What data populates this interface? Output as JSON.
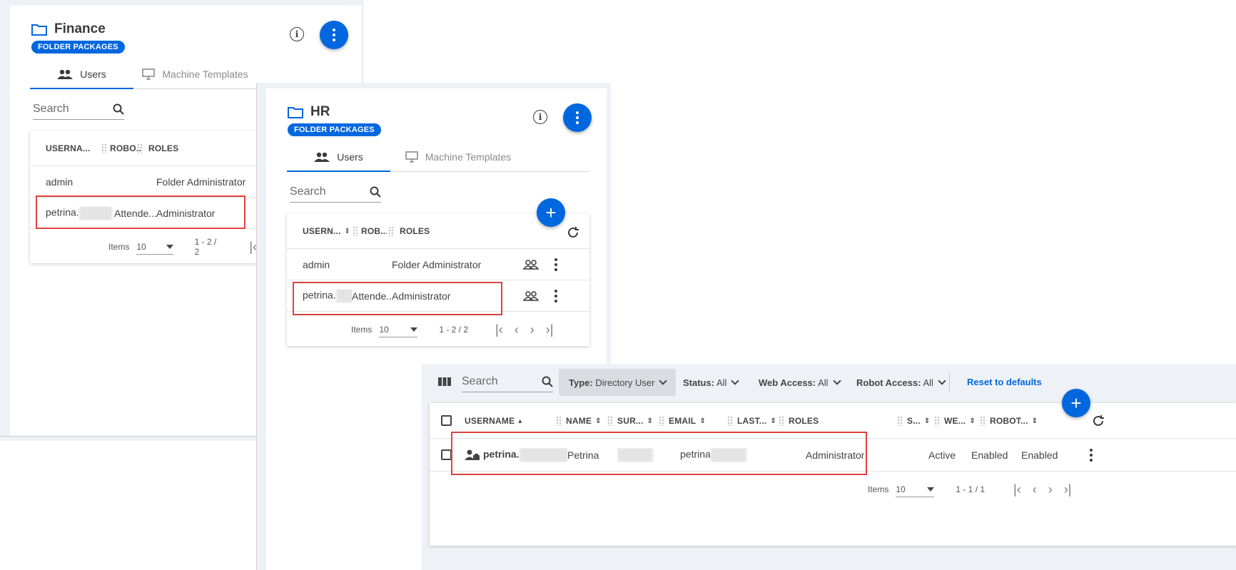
{
  "finance": {
    "title": "Finance",
    "badge": "FOLDER PACKAGES",
    "tabs": [
      "Users",
      "Machine Templates"
    ],
    "search_placeholder": "Search",
    "columns": [
      "USERNA...",
      "ROBO...",
      "ROLES"
    ],
    "rows": [
      {
        "username": "admin",
        "robot": "",
        "roles": "Folder Administrator"
      },
      {
        "username": "petrina.",
        "robot": "Attende...",
        "roles": "Administrator"
      }
    ],
    "items_label": "Items",
    "page_size": "10",
    "range": "1 - 2 / 2"
  },
  "hr": {
    "title": "HR",
    "badge": "FOLDER PACKAGES",
    "tabs": [
      "Users",
      "Machine Templates"
    ],
    "search_placeholder": "Search",
    "columns": [
      "USERN...",
      "ROB...",
      "ROLES"
    ],
    "rows": [
      {
        "username": "admin",
        "robot": "",
        "roles": "Folder Administrator"
      },
      {
        "username": "petrina.",
        "robot": "Attende...",
        "roles": "Administrator"
      }
    ],
    "items_label": "Items",
    "page_size": "10",
    "range": "1 - 2 / 2"
  },
  "users": {
    "search_placeholder": "Search",
    "filters": [
      {
        "key": "Type:",
        "value": "Directory User"
      },
      {
        "key": "Status:",
        "value": "All"
      },
      {
        "key": "Web Access:",
        "value": "All"
      },
      {
        "key": "Robot Access:",
        "value": "All"
      }
    ],
    "reset_label": "Reset to defaults",
    "columns": [
      "USERNAME",
      "NAME",
      "SUR...",
      "EMAIL",
      "LAST...",
      "ROLES",
      "S...",
      "WE...",
      "ROBOT..."
    ],
    "row": {
      "username": "petrina.",
      "name": "Petrina",
      "email": "petrina",
      "roles": "Administrator",
      "status": "Active",
      "web": "Enabled",
      "robot": "Enabled"
    },
    "items_label": "Items",
    "page_size": "10",
    "range": "1 - 1 / 1"
  },
  "colors": {
    "accent": "#0067df",
    "highlight": "#e04141"
  }
}
